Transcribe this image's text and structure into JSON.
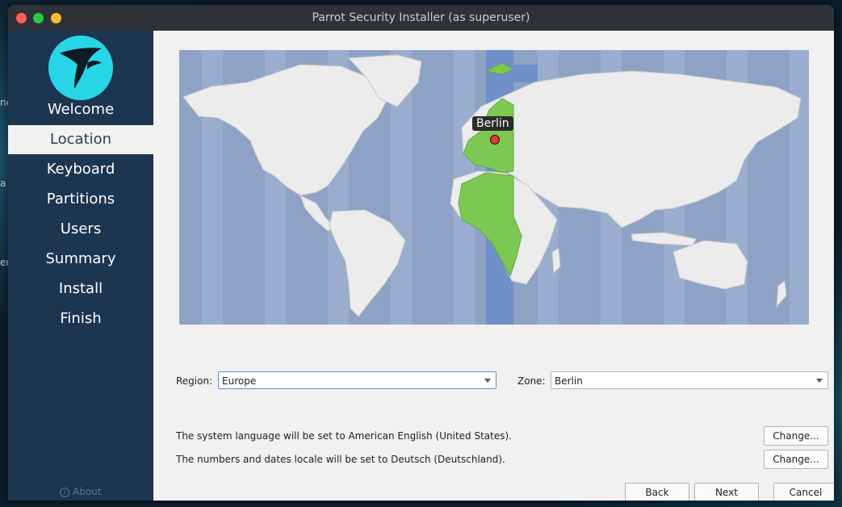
{
  "window": {
    "title": "Parrot Security Installer (as superuser)"
  },
  "desktop_fragments": [
    "ne",
    "a",
    "en"
  ],
  "sidebar": {
    "items": [
      {
        "label": "Welcome"
      },
      {
        "label": "Location",
        "active": true
      },
      {
        "label": "Keyboard"
      },
      {
        "label": "Partitions"
      },
      {
        "label": "Users"
      },
      {
        "label": "Summary"
      },
      {
        "label": "Install"
      },
      {
        "label": "Finish"
      }
    ],
    "about_label": "About"
  },
  "map": {
    "selected_city": "Berlin"
  },
  "region": {
    "label": "Region:",
    "value": "Europe"
  },
  "zone": {
    "label": "Zone:",
    "value": "Berlin"
  },
  "language_info": {
    "system_text": "The system language will be set to American English (United States).",
    "locale_text": "The numbers and dates locale will be set to Deutsch (Deutschland).",
    "change_label": "Change..."
  },
  "footer": {
    "back_label": "Back",
    "next_label": "Next",
    "cancel_label": "Cancel"
  },
  "colors": {
    "sidebar": "#1c3550",
    "accent_cyan": "#27d6e6",
    "map_water": "#8ea2c6",
    "land": "#ececec",
    "zone_highlight": "#7dc853",
    "timezone_band": "#6f90c9"
  }
}
